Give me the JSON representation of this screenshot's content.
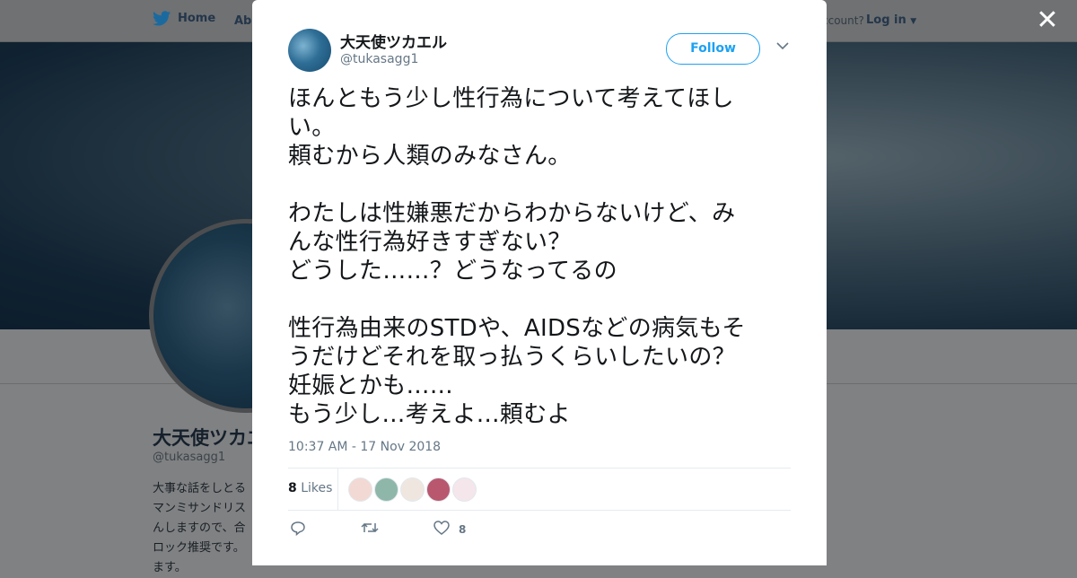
{
  "background": {
    "nav": {
      "home": "Home",
      "about": "Abo",
      "account": "ccount?",
      "login": "Log in"
    },
    "profile": {
      "name": "大天使ツカエ",
      "handle": "@tukasagg1",
      "bio": [
        "大事な話をしとる",
        "マンミサンドリス",
        "んしますので、合",
        "ロック推奨です。",
        "ます。"
      ]
    }
  },
  "modal": {
    "close_icon": "close-icon",
    "author": {
      "name": "大天使ツカエル",
      "handle": "@tukasagg1"
    },
    "follow_label": "Follow",
    "tweet_text": "ほんともう少し性行為について考えてほし\nい。\n頼むから人類のみなさん。\n\nわたしは性嫌悪だからわからないけど、み\nんな性行為好きすぎない？\nどうした……？どうなってるの\n\n性行為由来のSTDや、AIDSなどの病気もそ\nうだけどそれを取っ払うくらいしたいの？\n妊娠とかも……\nもう少し…考えよ…頼むよ",
    "timestamp": "10:37 AM - 17 Nov 2018",
    "likes": {
      "count": "8",
      "label": "Likes"
    },
    "liker_colors": [
      "#f3d9d3",
      "#8fb7a9",
      "#efe7df",
      "#b9576f",
      "#f4e6ea"
    ],
    "actions": {
      "reply_icon": "reply-icon",
      "retweet_icon": "retweet-icon",
      "like_icon": "heart-icon",
      "like_count": "8"
    }
  }
}
